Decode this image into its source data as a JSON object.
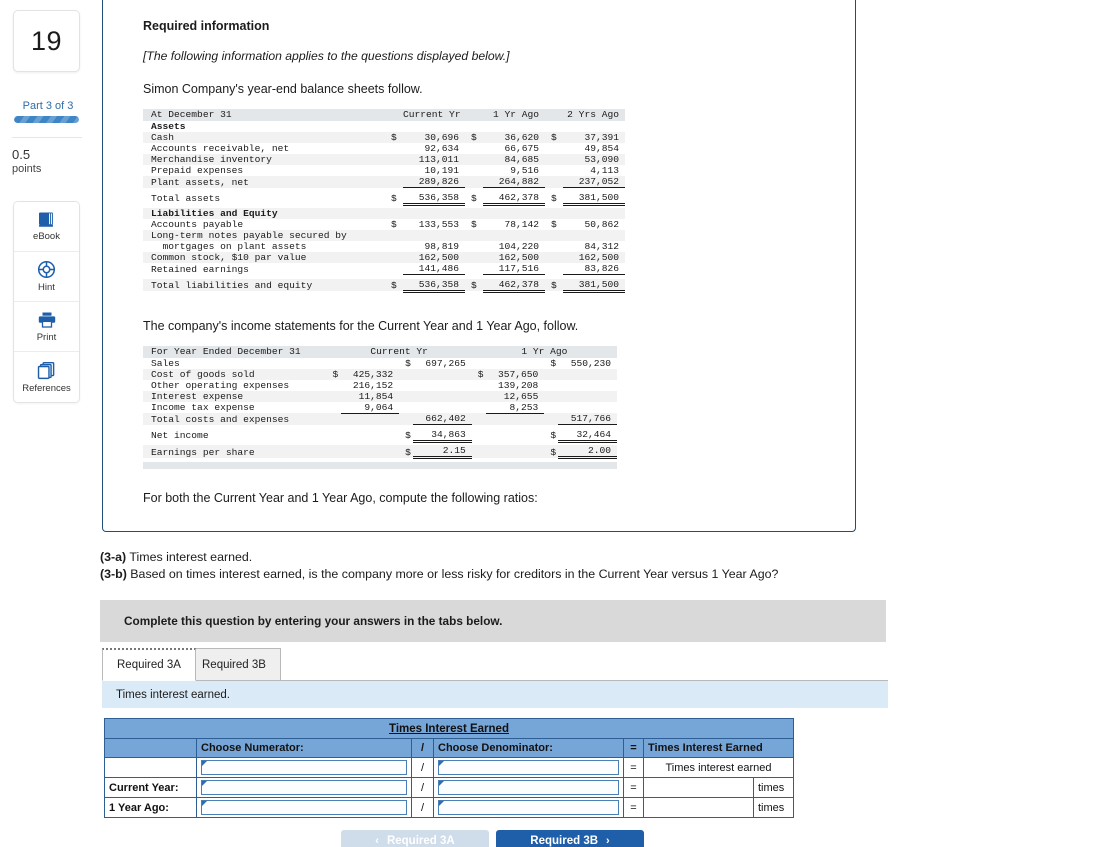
{
  "rail": {
    "question_number": "19",
    "part_label": "Part 3 of 3",
    "points_value": "0.5",
    "points_label": "points",
    "tools": [
      {
        "label": "eBook",
        "icon": "book-icon"
      },
      {
        "label": "Hint",
        "icon": "lifebuoy-icon"
      },
      {
        "label": "Print",
        "icon": "printer-icon"
      },
      {
        "label": "References",
        "icon": "copy-pages-icon"
      }
    ]
  },
  "info": {
    "heading": "Required information",
    "applies_note": "[The following information applies to the questions displayed below.]",
    "lead_balance": "Simon Company's year-end balance sheets follow.",
    "lead_income": "The company's income statements for the Current Year and 1 Year Ago, follow.",
    "lead_ratios": "For both the Current Year and 1 Year Ago, compute the following ratios:"
  },
  "balance_sheet": {
    "header": [
      "At December 31",
      "Current Yr",
      "1 Yr Ago",
      "2 Yrs Ago"
    ],
    "section_assets": "Assets",
    "section_liab": "Liabilities and Equity",
    "rows": [
      {
        "label": "Cash",
        "cur_sym": "$",
        "cur": "30,696",
        "y1_sym": "$",
        "y1": "36,620",
        "y2_sym": "$",
        "y2": "37,391"
      },
      {
        "label": "Accounts receivable, net",
        "cur_sym": "",
        "cur": "92,634",
        "y1_sym": "",
        "y1": "66,675",
        "y2_sym": "",
        "y2": "49,854"
      },
      {
        "label": "Merchandise inventory",
        "cur_sym": "",
        "cur": "113,011",
        "y1_sym": "",
        "y1": "84,685",
        "y2_sym": "",
        "y2": "53,090"
      },
      {
        "label": "Prepaid expenses",
        "cur_sym": "",
        "cur": "10,191",
        "y1_sym": "",
        "y1": "9,516",
        "y2_sym": "",
        "y2": "4,113"
      },
      {
        "label": "Plant assets, net",
        "cur_sym": "",
        "cur": "289,826",
        "y1_sym": "",
        "y1": "264,882",
        "y2_sym": "",
        "y2": "237,052"
      }
    ],
    "total_assets": {
      "label": "Total assets",
      "cur_sym": "$",
      "cur": "536,358",
      "y1_sym": "$",
      "y1": "462,378",
      "y2_sym": "$",
      "y2": "381,500"
    },
    "liab_rows": [
      {
        "label": "Accounts payable",
        "cur_sym": "$",
        "cur": "133,553",
        "y1_sym": "$",
        "y1": "78,142",
        "y2_sym": "$",
        "y2": "50,862"
      },
      {
        "label": "Long-term notes payable secured by",
        "cur_sym": "",
        "cur": "",
        "y1_sym": "",
        "y1": "",
        "y2_sym": "",
        "y2": ""
      },
      {
        "label": "  mortgages on plant assets",
        "cur_sym": "",
        "cur": "98,819",
        "y1_sym": "",
        "y1": "104,220",
        "y2_sym": "",
        "y2": "84,312"
      },
      {
        "label": "Common stock, $10 par value",
        "cur_sym": "",
        "cur": "162,500",
        "y1_sym": "",
        "y1": "162,500",
        "y2_sym": "",
        "y2": "162,500"
      },
      {
        "label": "Retained earnings",
        "cur_sym": "",
        "cur": "141,486",
        "y1_sym": "",
        "y1": "117,516",
        "y2_sym": "",
        "y2": "83,826"
      }
    ],
    "total_liab": {
      "label": "Total liabilities and equity",
      "cur_sym": "$",
      "cur": "536,358",
      "y1_sym": "$",
      "y1": "462,378",
      "y2_sym": "$",
      "y2": "381,500"
    }
  },
  "income_statement": {
    "header": [
      "For Year Ended December 31",
      "Current Yr",
      "1 Yr Ago"
    ],
    "sales": {
      "label": "Sales",
      "cur_sym": "$",
      "cur": "697,265",
      "y1_sym": "$",
      "y1": "550,230"
    },
    "costs": [
      {
        "label": "Cost of goods sold",
        "cur_sym": "$",
        "cur": "425,332",
        "y1_sym": "$",
        "y1": "357,650"
      },
      {
        "label": "Other operating expenses",
        "cur_sym": "",
        "cur": "216,152",
        "y1_sym": "",
        "y1": "139,208"
      },
      {
        "label": "Interest expense",
        "cur_sym": "",
        "cur": "11,854",
        "y1_sym": "",
        "y1": "12,655"
      },
      {
        "label": "Income tax expense",
        "cur_sym": "",
        "cur": "9,064",
        "y1_sym": "",
        "y1": "8,253"
      }
    ],
    "total_costs": {
      "label": "Total costs and expenses",
      "cur_sym": "",
      "cur": "662,402",
      "y1_sym": "",
      "y1": "517,766"
    },
    "net_income": {
      "label": "Net income",
      "cur_sym": "$",
      "cur": "34,863",
      "y1_sym": "$",
      "y1": "32,464"
    },
    "eps": {
      "label": "Earnings per share",
      "cur_sym": "$",
      "cur": "2.15",
      "y1_sym": "$",
      "y1": "2.00"
    }
  },
  "questions": {
    "a_tag": "(3-a)",
    "a_text": "Times interest earned.",
    "b_tag": "(3-b)",
    "b_text": "Based on times interest earned, is the company more or less risky for creditors in the Current Year versus 1 Year Ago?"
  },
  "instruction_banner": "Complete this question by entering your answers in the tabs below.",
  "tabs": {
    "active_label": "Required 3A",
    "inactive_label": "Required 3B"
  },
  "tab_prompt": "Times interest earned.",
  "answer_table": {
    "title": "Times Interest Earned",
    "headers": {
      "rowlabel": "",
      "numerator": "Choose Numerator:",
      "slash": "/",
      "denominator": "Choose Denominator:",
      "equals": "=",
      "result": "Times Interest Earned"
    },
    "rows": [
      {
        "label": "",
        "numerator": "",
        "slash": "/",
        "denominator": "",
        "equals": "=",
        "result": "Times interest earned",
        "unit": ""
      },
      {
        "label": "Current Year:",
        "numerator": "",
        "slash": "/",
        "denominator": "",
        "equals": "=",
        "result": "",
        "unit": "times"
      },
      {
        "label": "1 Year Ago:",
        "numerator": "",
        "slash": "/",
        "denominator": "",
        "equals": "=",
        "result": "",
        "unit": "times"
      }
    ]
  },
  "nav": {
    "prev_label": "Required 3A",
    "next_label": "Required 3B",
    "prev_chevron": "‹",
    "next_chevron": "›"
  },
  "colors": {
    "accent_blue": "#1f5faa",
    "table_header_blue": "#76a5d8",
    "banner_blue": "#dbeaf7",
    "banner_gray": "#d9d9d9",
    "card_border": "#1f4e79"
  }
}
